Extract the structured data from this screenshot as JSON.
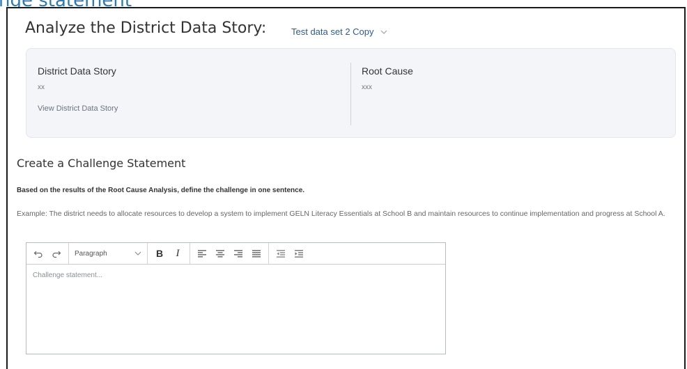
{
  "background_caption": "nge statement",
  "header": {
    "title": "Analyze the District Data Story:",
    "dataset_selector": {
      "value": "Test data set 2 Copy"
    }
  },
  "summary_card": {
    "district_data_story": {
      "title": "District Data Story",
      "value": "xx",
      "link": "View District Data Story"
    },
    "root_cause": {
      "title": "Root Cause",
      "value": "xxx"
    }
  },
  "challenge_section": {
    "title": "Create a Challenge Statement",
    "instruction": "Based on the results of the Root Cause Analysis, define the challenge in one sentence.",
    "example": "Example: The district needs to allocate resources to develop a system to implement GELN Literacy Essentials at School B and maintain resources to continue implementation and progress at School A."
  },
  "editor": {
    "toolbar": {
      "undo_icon": "undo-icon",
      "redo_icon": "redo-icon",
      "block_format": "Paragraph",
      "bold_label": "B",
      "italic_label": "I",
      "align_icons": [
        "align-left-icon",
        "align-center-icon",
        "align-right-icon",
        "align-justify-icon"
      ],
      "indent_icons": [
        "outdent-icon",
        "indent-icon"
      ]
    },
    "placeholder": "Challenge statement..."
  },
  "colors": {
    "link_blue": "#2b5a9a",
    "caption_blue": "#2a7ab5",
    "card_bg": "#f3f5f8",
    "frame_border": "#1a1a1a"
  }
}
